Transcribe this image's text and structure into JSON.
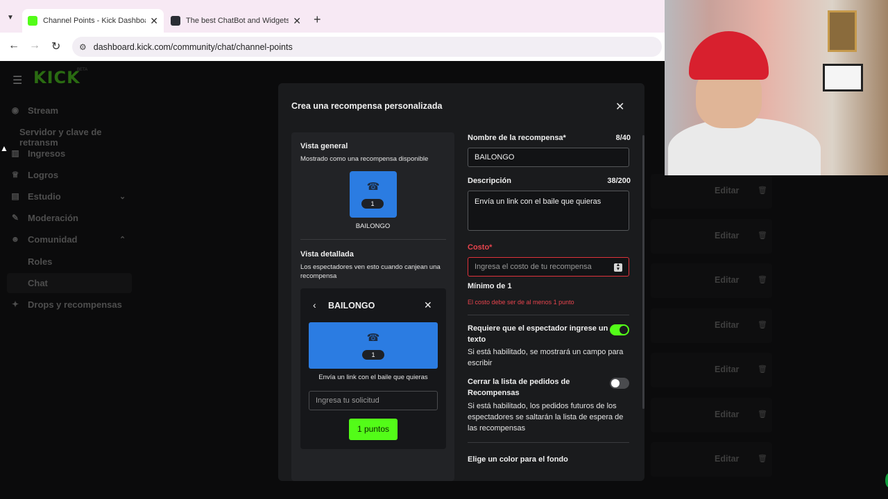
{
  "browser": {
    "tabs": [
      {
        "title": "Channel Points - Kick Dashboar",
        "favicon_color": "#53fc18"
      },
      {
        "title": "The best ChatBot and Widgets f",
        "favicon_color": "#2a2d34"
      }
    ],
    "url": "dashboard.kick.com/community/chat/channel-points"
  },
  "sidebar": {
    "logo": "KICK",
    "logo_badge": "BETA",
    "items": [
      {
        "label": "Stream"
      },
      {
        "label": "Servidor y clave de retransm"
      },
      {
        "label": "Ingresos"
      },
      {
        "label": "Logros"
      },
      {
        "label": "Estudio"
      },
      {
        "label": "Moderación"
      },
      {
        "label": "Comunidad"
      },
      {
        "label": "Roles"
      },
      {
        "label": "Chat"
      },
      {
        "label": "Drops y recompensas"
      }
    ]
  },
  "reward_list": {
    "edit_label": "Editar"
  },
  "modal": {
    "title": "Crea una recompensa personalizada",
    "preview": {
      "general_heading": "Vista general",
      "general_sub": "Mostrado como una recompensa disponible",
      "badge_count": "1",
      "reward_name": "BAILONGO",
      "detail_heading": "Vista detallada",
      "detail_sub": "Los espectadores ven esto cuando canjean una recompensa",
      "detail_title": "BAILONGO",
      "detail_description": "Envía un link con el baile que quieras",
      "request_placeholder": "Ingresa tu solicitud",
      "points_button": "1 puntos"
    },
    "form": {
      "name_label": "Nombre de la recompensa*",
      "name_count": "8/40",
      "name_value": "BAILONGO",
      "desc_label": "Descripción",
      "desc_count": "38/200",
      "desc_value": "Envía un link con el baile que quieras",
      "cost_label": "Costo*",
      "cost_placeholder": "Ingresa el costo de tu recompensa",
      "cost_min": "Mínimo de 1",
      "cost_error": "El costo debe ser de al menos 1 punto",
      "require_text_label": "Requiere que el espectador ingrese un texto",
      "require_text_help": "Si está habilitado, se mostrará un campo para escribir",
      "require_text_enabled": true,
      "close_queue_label": "Cerrar la lista de pedidos de Recompensas",
      "close_queue_help": "Si está habilitado, los pedidos futuros de los espectadores se saltarán la lista de espera de las recompensas",
      "close_queue_enabled": false,
      "color_label": "Elige un color para el fondo"
    }
  },
  "colors": {
    "accent": "#53fc18",
    "reward_tile": "#2b7ce2",
    "error": "#e8444d"
  }
}
